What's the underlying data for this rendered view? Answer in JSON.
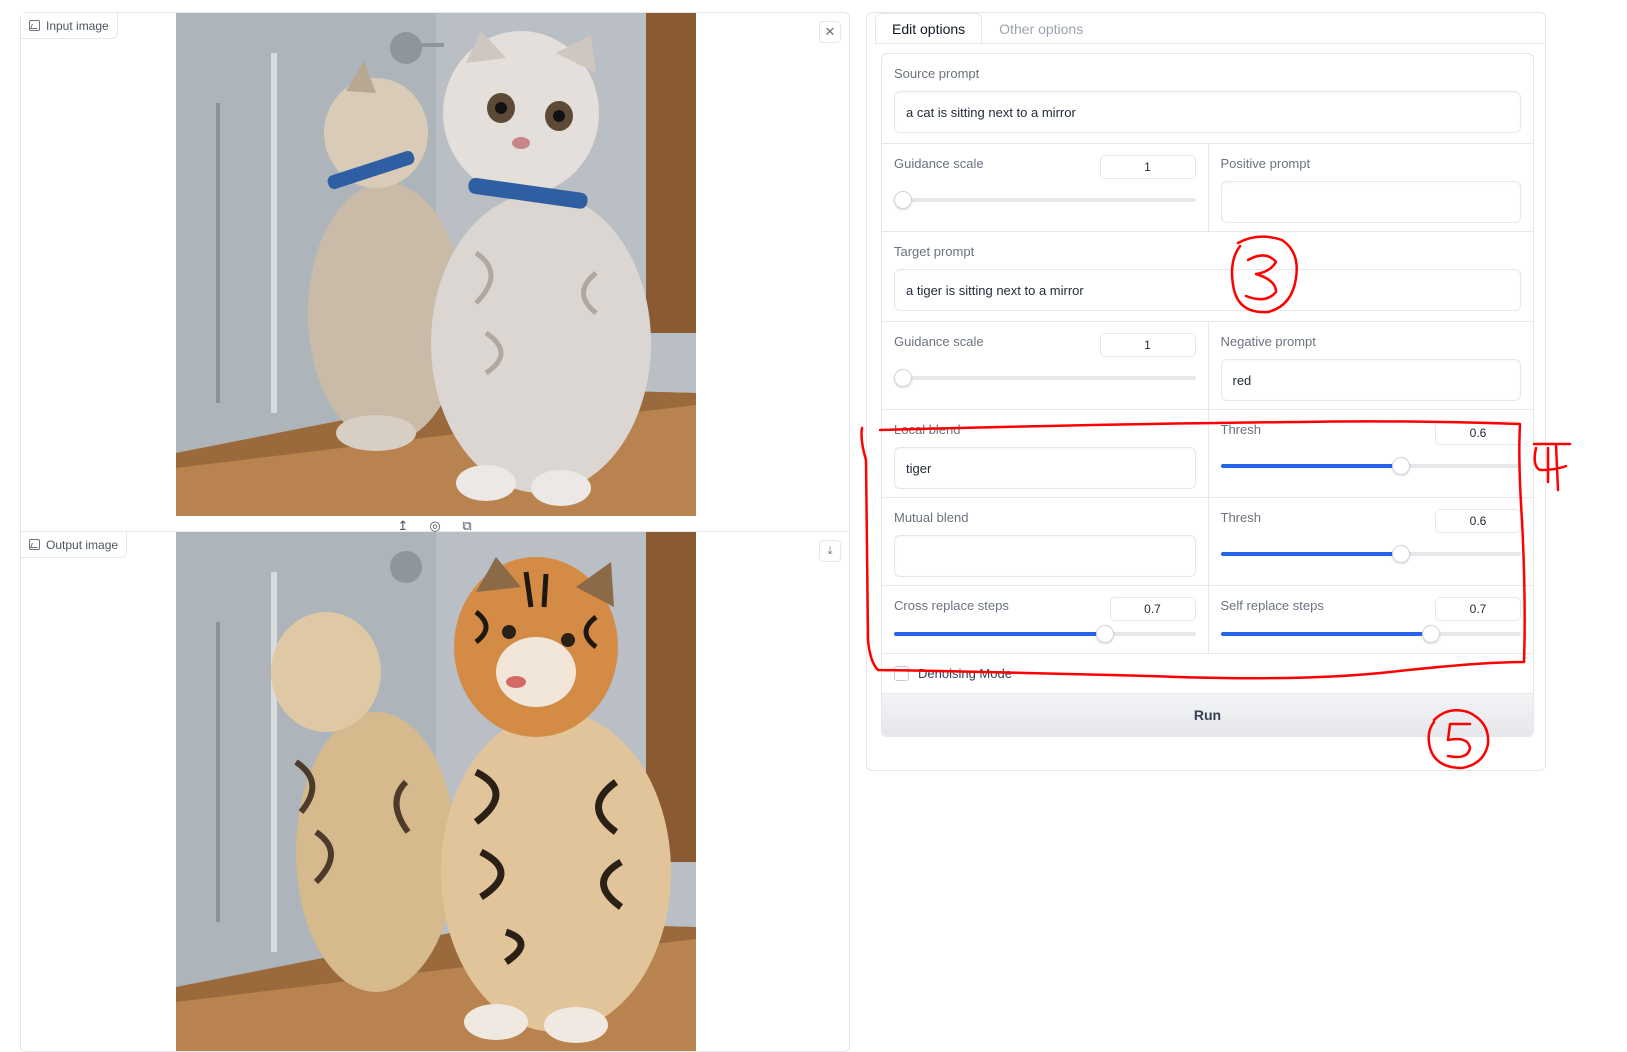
{
  "input_panel": {
    "label": "Input image",
    "close_icon": "close-icon",
    "tools": [
      "upload-icon",
      "webcam-icon",
      "clipboard-icon"
    ]
  },
  "output_panel": {
    "label": "Output image",
    "download_icon": "download-icon"
  },
  "tabs": [
    {
      "label": "Edit options",
      "active": true
    },
    {
      "label": "Other options",
      "active": false
    }
  ],
  "form": {
    "source_prompt": {
      "label": "Source prompt",
      "value": "a cat is sitting next to a mirror"
    },
    "source_guidance": {
      "label": "Guidance scale",
      "value": "1",
      "level": 0
    },
    "positive_prompt": {
      "label": "Positive prompt",
      "value": ""
    },
    "target_prompt": {
      "label": "Target prompt",
      "value": "a tiger is sitting next to a mirror"
    },
    "target_guidance": {
      "label": "Guidance scale",
      "value": "1",
      "level": 0
    },
    "negative_prompt": {
      "label": "Negative prompt",
      "value": "red"
    },
    "local_blend": {
      "label": "Local blend",
      "value": "tiger"
    },
    "local_thresh": {
      "label": "Thresh",
      "value": "0.6",
      "level": 0.6
    },
    "mutual_blend": {
      "label": "Mutual blend",
      "value": ""
    },
    "mutual_thresh": {
      "label": "Thresh",
      "value": "0.6",
      "level": 0.6
    },
    "cross_replace_steps": {
      "label": "Cross replace steps",
      "value": "0.7",
      "level": 0.7
    },
    "self_replace_steps": {
      "label": "Self replace steps",
      "value": "0.7",
      "level": 0.7
    },
    "denoising_mode": {
      "label": "Denoising Mode",
      "checked": false
    },
    "run_label": "Run"
  },
  "annotations": {
    "color": "#ff0000",
    "marks": [
      "3",
      "4",
      "5"
    ]
  },
  "colors": {
    "accent": "#2563eb",
    "border": "#e5e7eb"
  }
}
